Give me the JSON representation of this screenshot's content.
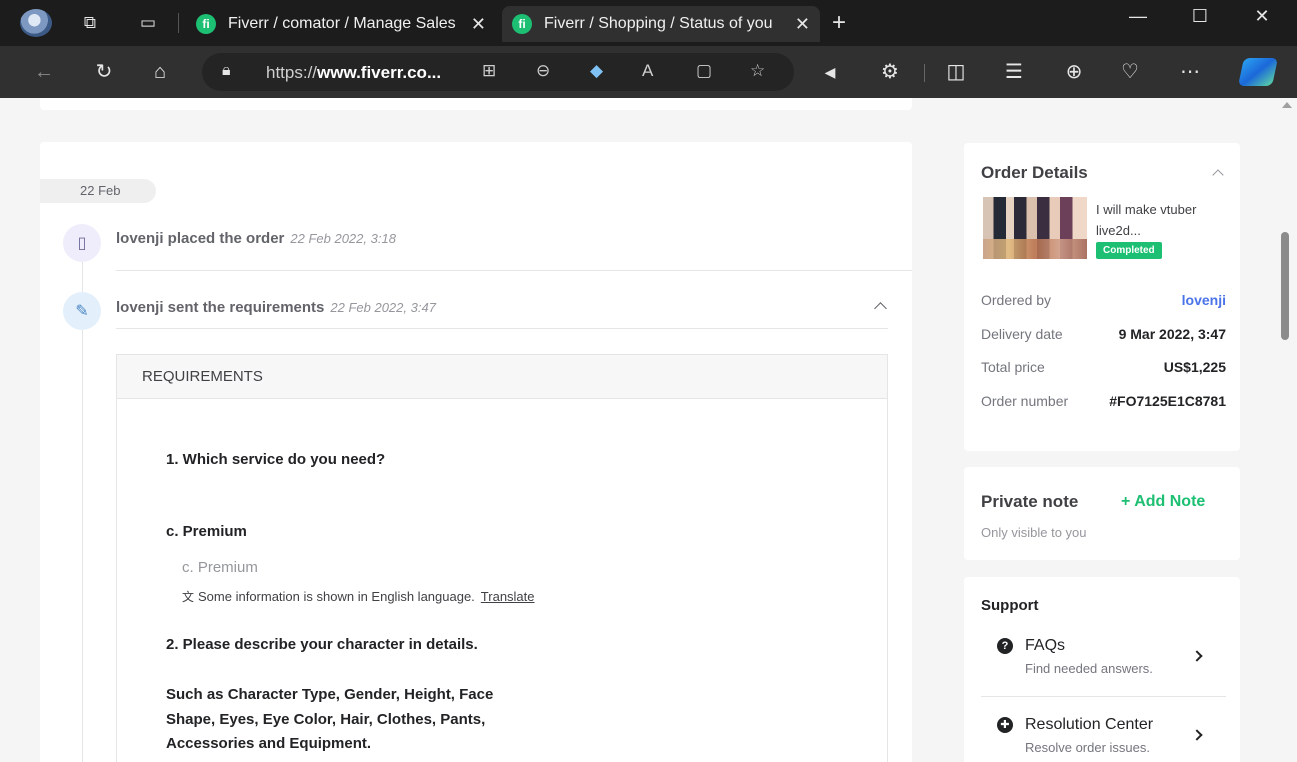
{
  "browser": {
    "tabs": [
      {
        "title": "Fiverr / comator / Manage Sales",
        "favicon": "fi",
        "active": false
      },
      {
        "title": "Fiverr / Shopping / Status of you",
        "favicon": "fi",
        "active": true
      }
    ],
    "address": {
      "prefix": "https://",
      "domain": "www.fiverr.co",
      "suffix": "..."
    }
  },
  "timeline": {
    "date_chip": "22 Feb",
    "events": [
      {
        "text": "lovenji placed the order",
        "time": "22 Feb 2022, 3:18"
      },
      {
        "text": "lovenji sent the requirements",
        "time": "22 Feb 2022, 3:47"
      }
    ],
    "requirements": {
      "header": "REQUIREMENTS",
      "q1": "1. Which service do you need?",
      "a1_bold": "c. Premium",
      "a1_plain": "c. Premium",
      "translate_note": "Some information is shown in English language.",
      "translate_link": "Translate",
      "q2": "2. Please describe your character in details.",
      "q2_detail": "Such as Character Type, Gender, Height, Face Shape, Eyes, Eye Color, Hair, Clothes, Pants, Accessories and Equipment."
    }
  },
  "order_details": {
    "title": "Order Details",
    "gig_title": "I will make vtuber live2d...",
    "status": "Completed",
    "rows": [
      {
        "label": "Ordered by",
        "value": "lovenji"
      },
      {
        "label": "Delivery date",
        "value": "9 Mar 2022, 3:47"
      },
      {
        "label": "Total price",
        "value": "US$1,225"
      },
      {
        "label": "Order number",
        "value": "#FO7125E1C8781"
      }
    ]
  },
  "private_note": {
    "title": "Private note",
    "add_label": "+ Add Note",
    "subtitle": "Only visible to you"
  },
  "support": {
    "title": "Support",
    "items": [
      {
        "label": "FAQs",
        "sub": "Find needed answers."
      },
      {
        "label": "Resolution Center",
        "sub": "Resolve order issues."
      }
    ]
  },
  "colors": {
    "brand_green": "#1dbf73",
    "link_blue": "#4a73e8"
  }
}
